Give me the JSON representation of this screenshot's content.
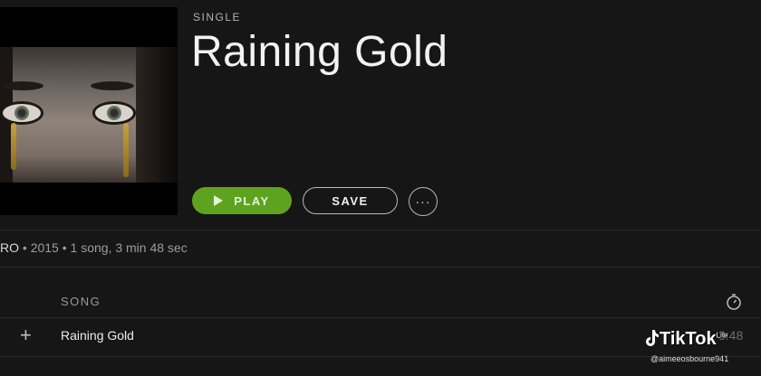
{
  "album": {
    "type_label": "SINGLE",
    "title": "Raining Gold"
  },
  "actions": {
    "play_label": "PLAY",
    "save_label": "SAVE",
    "more_label": "···"
  },
  "meta": {
    "artist": "RO",
    "separator1": " • ",
    "year": "2015",
    "separator2": " • ",
    "summary": "1 song, 3 min 48 sec"
  },
  "tracklist": {
    "column_song": "SONG",
    "tracks": [
      {
        "title": "Raining Gold",
        "duration": "3:48"
      }
    ]
  },
  "watermark": {
    "brand": "TikTok",
    "suffix": "Lite",
    "handle": "@aimeeosbourne941"
  },
  "colors": {
    "background": "#161616",
    "accent_green": "#5ea31f"
  },
  "icons": {
    "play": "play-icon",
    "more": "more-icon",
    "clock": "clock-icon",
    "add": "plus-icon",
    "tiktok": "tiktok-note-icon"
  }
}
